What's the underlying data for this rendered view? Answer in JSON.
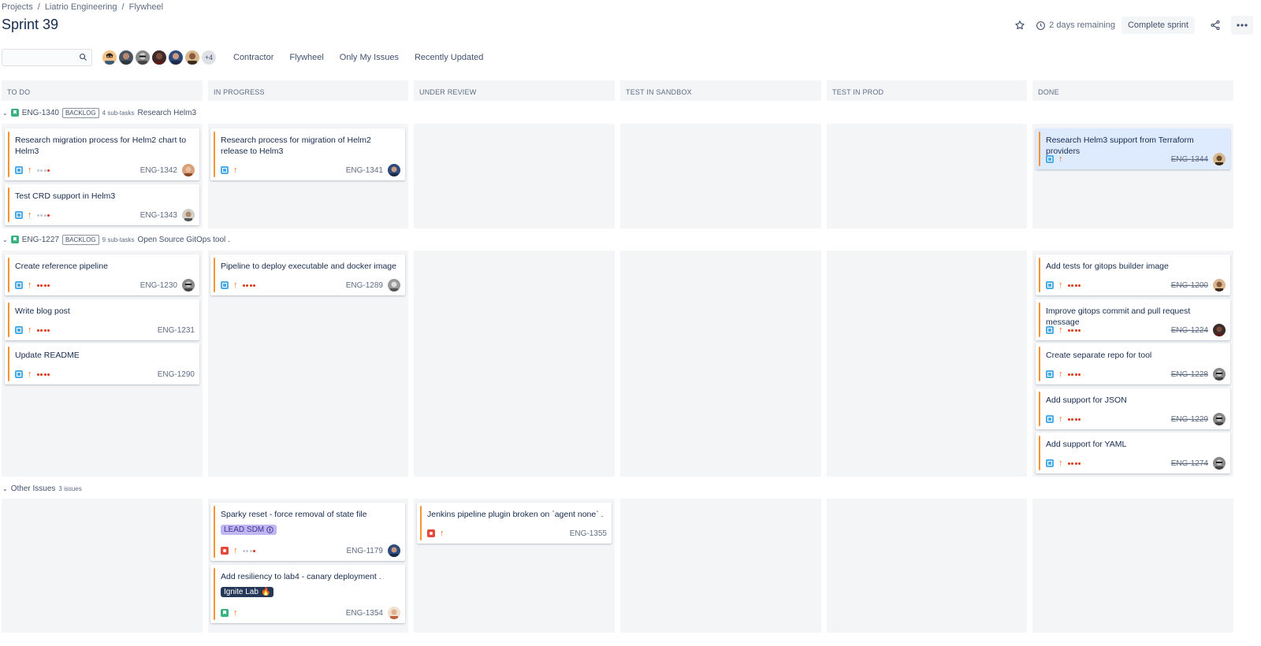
{
  "breadcrumb": [
    "Projects",
    "Liatrio Engineering",
    "Flywheel"
  ],
  "title": "Sprint 39",
  "header": {
    "remaining": "2 days remaining",
    "complete_label": "Complete sprint"
  },
  "toolbar": {
    "search_value": "",
    "avatars_more": "+4",
    "filters": [
      "Contractor",
      "Flywheel",
      "Only My Issues",
      "Recently Updated"
    ]
  },
  "columns": [
    "TO DO",
    "IN PROGRESS",
    "UNDER REVIEW",
    "TEST IN SANDBOX",
    "TEST IN PROD",
    "DONE"
  ],
  "lanes": [
    {
      "key": "ENG-1340",
      "badge": "BACKLOG",
      "subtasks": "4 sub-tasks",
      "summary": "Research Helm3"
    },
    {
      "key": "ENG-1227",
      "badge": "BACKLOG",
      "subtasks": "9 sub-tasks",
      "summary": "Open Source GitOps tool ."
    },
    {
      "name": "Other Issues",
      "count": "3 issues"
    }
  ],
  "cards": [
    {
      "title": "Research migration process for Helm2 chart to Helm3",
      "key": "ENG-1342"
    },
    {
      "title": "Test CRD support in Helm3",
      "key": "ENG-1343"
    },
    {
      "title": "Research process for migration of Helm2 release to Helm3",
      "key": "ENG-1341"
    },
    {
      "title": "Research Helm3 support from Terraform providers",
      "key": "ENG-1344"
    },
    {
      "title": "Create reference pipeline",
      "key": "ENG-1230"
    },
    {
      "title": "Write blog post",
      "key": "ENG-1231"
    },
    {
      "title": "Update README",
      "key": "ENG-1290"
    },
    {
      "title": "Pipeline to deploy executable and docker image",
      "key": "ENG-1289"
    },
    {
      "title": "Add tests for gitops builder image",
      "key": "ENG-1200"
    },
    {
      "title": "Improve gitops commit and pull request message",
      "key": "ENG-1224"
    },
    {
      "title": "Create separate repo for tool",
      "key": "ENG-1228"
    },
    {
      "title": "Add support for JSON",
      "key": "ENG-1229"
    },
    {
      "title": "Add support for YAML",
      "key": "ENG-1274"
    },
    {
      "title": "Sparky reset - force removal of state file",
      "label": "LEAD SDM",
      "key": "ENG-1179"
    },
    {
      "title": "Add resiliency to lab4 - canary deployment .",
      "label": "Ignite Lab",
      "key": "ENG-1354"
    },
    {
      "title": "Jenkins pipeline plugin broken on `agent none` .",
      "key": "ENG-1355"
    }
  ],
  "colors": {
    "accent_border": "#f79232",
    "subtask": "#4bade8",
    "bug": "#e5493a",
    "story": "#36b37e",
    "done_card": "#deebff"
  }
}
